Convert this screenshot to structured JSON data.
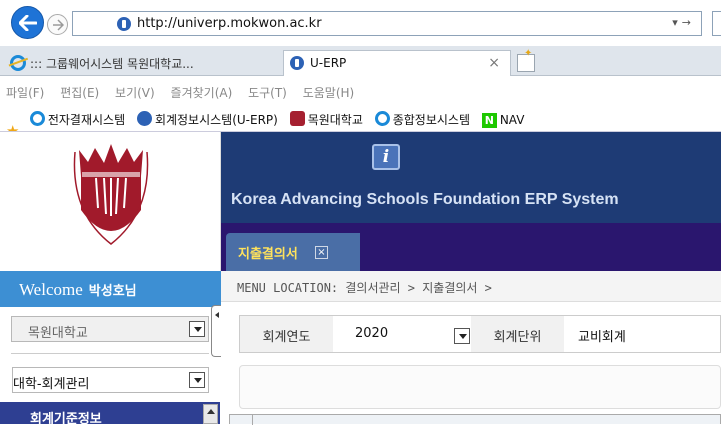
{
  "browser": {
    "url": "http://univerp.mokwon.ac.kr",
    "tabs": [
      {
        "label": "::: 그룹웨어시스템 목원대학교..."
      },
      {
        "label": "U-ERP",
        "close": "×"
      }
    ],
    "menu": [
      "파일(F)",
      "편집(E)",
      "보기(V)",
      "즐겨찾기(A)",
      "도구(T)",
      "도움말(H)"
    ],
    "favorites": [
      {
        "label": "전자결재시스템",
        "icon": "ie-icon"
      },
      {
        "label": "회계정보시스템(U-ERP)",
        "icon": "erp-icon"
      },
      {
        "label": "목원대학교",
        "icon": "university-icon"
      },
      {
        "label": "종합정보시스템",
        "icon": "ie-icon"
      },
      {
        "label": "NAV",
        "icon": "naver-icon"
      }
    ]
  },
  "header": {
    "system_title": "Korea Advancing Schools Foundation ERP System",
    "info_icon": "i",
    "work_tab": {
      "label": "지출결의서",
      "close": "×"
    }
  },
  "sidebar": {
    "welcome_prefix": "Welcome",
    "user_name": "박성호님",
    "org_select": "목원대학교",
    "module_select": "대학-회계관리",
    "menu_header": "회계기준정보"
  },
  "content": {
    "location": "MENU LOCATION: 결의서관리 > 지출결의서 >",
    "fields": {
      "year_label": "회계연도",
      "year_value": "2020",
      "unit_label": "회계단위",
      "unit_value": "교비회계"
    }
  },
  "colors": {
    "header_navy": "#1e3b75",
    "tabs_purple": "#2a166e",
    "welcome_blue": "#3d8fd3",
    "work_tab_label": "#ffe25c"
  }
}
